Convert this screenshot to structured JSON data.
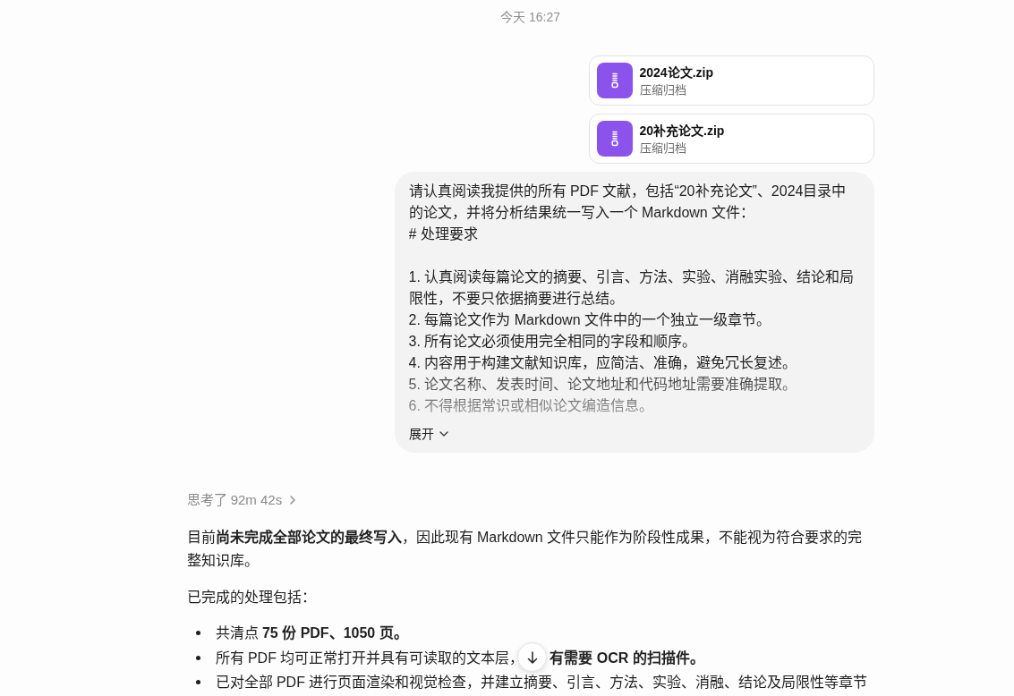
{
  "timestamp": "今天 16:27",
  "attachments": [
    {
      "name": "2024论文.zip",
      "type": "压缩归档"
    },
    {
      "name": "20补充论文.zip",
      "type": "压缩归档"
    }
  ],
  "user_message": {
    "expanded": false,
    "paragraphs": [
      {
        "lines": [
          "请认真阅读我提供的所有 PDF 文献，包括“20补充论文”、2024目录中的论文，并将分析结果统一写入一个 Markdown 文件：",
          "# 处理要求"
        ]
      },
      {
        "lines": [
          "1. 认真阅读每篇论文的摘要、引言、方法、实验、消融实验、结论和局限性，不要只依据摘要进行总结。",
          "2. 每篇论文作为 Markdown 文件中的一个独立一级章节。",
          "3. 所有论文必须使用完全相同的字段和顺序。",
          "4. 内容用于构建文献知识库，应简洁、准确，避免冗长复述。",
          "5. 论文名称、发表时间、论文地址和代码地址需要准确提取。",
          "6. 不得根据常识或相似论文编造信息。"
        ]
      }
    ],
    "toggle_label": "展开"
  },
  "response": {
    "thinking_label": "思考了 92m 42s",
    "blocks": [
      {
        "kind": "paragraph",
        "text": "目前**尚未完成全部论文的最终写入**，因此现有 Markdown 文件只能作为阶段性成果，不能视为符合要求的完整知识库。"
      },
      {
        "kind": "paragraph",
        "text": "已完成的处理包括："
      },
      {
        "kind": "bullets",
        "items": [
          {
            "parts": [
              "共清点 **75 份 PDF、1050 页。**"
            ]
          },
          {
            "parts": [
              "所有 PDF 均可正常打开并具有可读取的文本层，",
              "**有需要 OCR 的扫描件。**"
            ]
          },
          {
            "parts": [
              "已对全部 PDF 进行页面渲染和视觉检查，并建立摘要、引言、方法、实验、消融、结论及局限性等章节"
            ]
          }
        ]
      }
    ]
  }
}
